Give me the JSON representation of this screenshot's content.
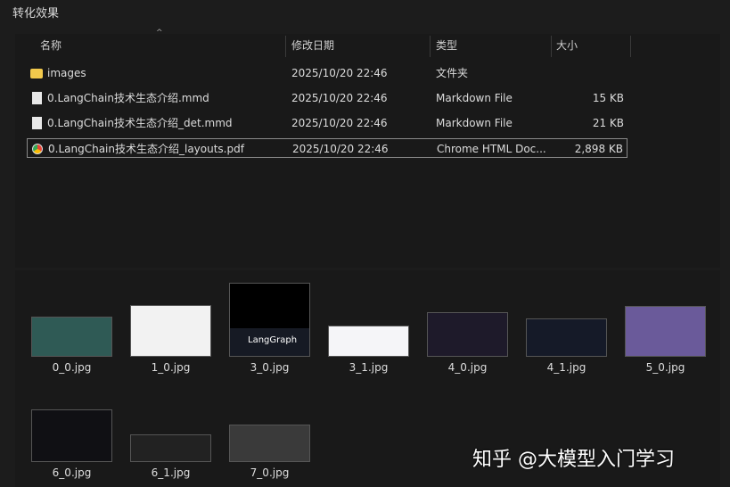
{
  "window": {
    "title": "转化效果"
  },
  "columns": {
    "name": "名称",
    "date": "修改日期",
    "type": "类型",
    "size": "大小"
  },
  "files": [
    {
      "name": "images",
      "date": "2025/10/20 22:46",
      "type": "文件夹",
      "size": "",
      "icon": "folder-icon"
    },
    {
      "name": "0.LangChain技术生态介绍.mmd",
      "date": "2025/10/20 22:46",
      "type": "Markdown File",
      "size": "15 KB",
      "icon": "markdown-file-icon"
    },
    {
      "name": "0.LangChain技术生态介绍_det.mmd",
      "date": "2025/10/20 22:46",
      "type": "Markdown File",
      "size": "21 KB",
      "icon": "markdown-file-icon"
    },
    {
      "name": "0.LangChain技术生态介绍_layouts.pdf",
      "date": "2025/10/20 22:46",
      "type": "Chrome HTML Doc...",
      "size": "2,898 KB",
      "icon": "chrome-icon"
    }
  ],
  "thumbnails": [
    {
      "name": "0_0.jpg",
      "color": "#2f5a55"
    },
    {
      "name": "1_0.jpg",
      "color": "#f2f2f2"
    },
    {
      "name": "3_0.jpg",
      "color": "#000000",
      "caption": "LangGraph"
    },
    {
      "name": "3_1.jpg",
      "color": "#f5f5f8"
    },
    {
      "name": "4_0.jpg",
      "color": "#1e1a2a"
    },
    {
      "name": "4_1.jpg",
      "color": "#151a28"
    },
    {
      "name": "5_0.jpg",
      "color": "#6a5a9a"
    },
    {
      "name": "6_0.jpg",
      "color": "#101014"
    },
    {
      "name": "6_1.jpg",
      "color": "#222222"
    },
    {
      "name": "7_0.jpg",
      "color": "#3a3a3a"
    }
  ],
  "watermark": "知乎 @大模型入门学习"
}
